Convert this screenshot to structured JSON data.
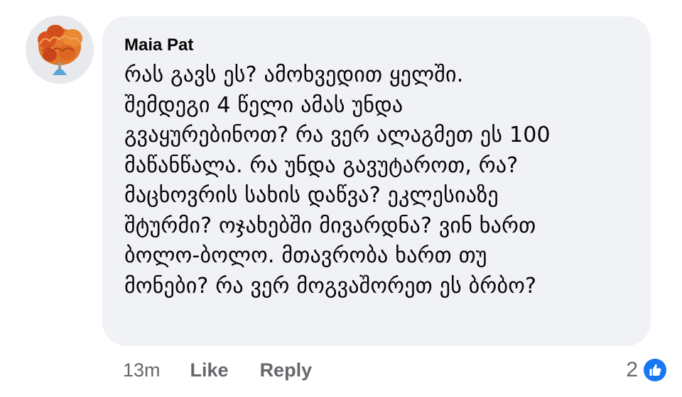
{
  "comment": {
    "author": "Maia Pat",
    "lines": [
      "რას გავს ეს? ამოხვედით ყელში.",
      "შემდეგი 4 წელი ამას უნდა",
      "გვაყურებინოთ? რა ვერ ალაგმეთ ეს 100",
      "მაწანწალა. რა უნდა გავუტაროთ, რა?",
      "მაცხოვრის სახის დაწვა? ეკლესიაზე",
      "შტურმი? ოჯახებში მივარდნა? ვინ ხართ",
      "ბოლო-ბოლო. მთავრობა ხართ თუ",
      "მონები?  რა ვერ მოგვაშორეთ ეს ბრბო?"
    ],
    "timestamp": "13m",
    "like_label": "Like",
    "reply_label": "Reply",
    "reaction_count": "2",
    "reaction_icon": "like-thumbs-up-icon"
  },
  "colors": {
    "bubble_bg": "#f0f2f5",
    "text": "#050505",
    "secondary_text": "#65676b",
    "like_blue": "#1877f2"
  }
}
